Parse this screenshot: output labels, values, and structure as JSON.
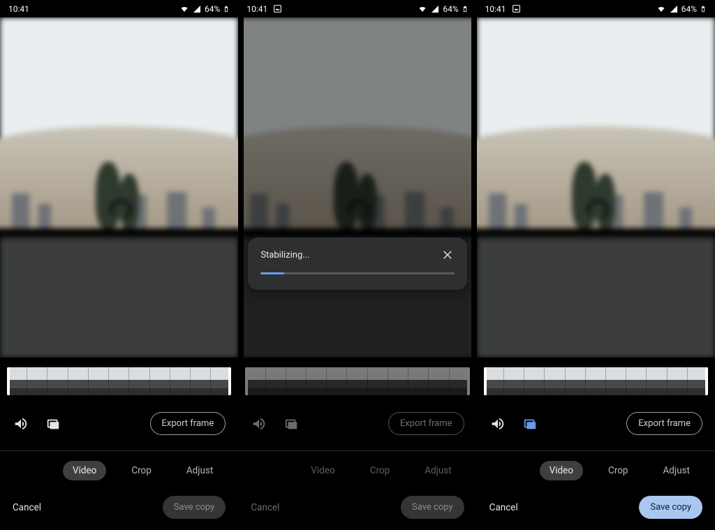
{
  "status": {
    "time": "10:41",
    "battery": "64%",
    "show_image_icon_in_left": [
      false,
      true,
      true
    ]
  },
  "stabilize_dialog": {
    "title": "Stabilizing...",
    "progress_percent": 12
  },
  "timeline": {
    "thumb_count": 11
  },
  "tools": {
    "export_frame_label": "Export frame"
  },
  "tabs": {
    "video": "Video",
    "crop": "Crop",
    "adjust": "Adjust"
  },
  "actions": {
    "cancel": "Cancel",
    "save_copy": "Save copy"
  },
  "panels": [
    {
      "dimmed": false,
      "show_stabilize_dialog": false,
      "stabilize_icon_active": false,
      "controls_enabled": true,
      "save_enabled": false,
      "trim_handles": true
    },
    {
      "dimmed": true,
      "show_stabilize_dialog": true,
      "stabilize_icon_active": false,
      "controls_enabled": false,
      "save_enabled": false,
      "trim_handles": false
    },
    {
      "dimmed": false,
      "show_stabilize_dialog": false,
      "stabilize_icon_active": true,
      "controls_enabled": true,
      "save_enabled": true,
      "trim_handles": true
    }
  ]
}
